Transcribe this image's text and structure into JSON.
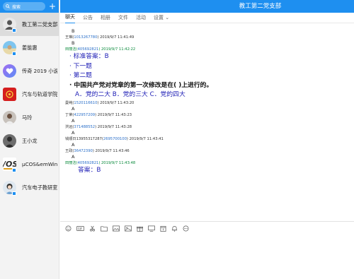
{
  "app": {
    "title": "教工第二党支部"
  },
  "sidebar": {
    "search_label": "搜索",
    "add_label": "+",
    "conversations": [
      {
        "name": "教工第二党支部"
      },
      {
        "name": "姜能惠"
      },
      {
        "name": "传奇 2019 小说"
      },
      {
        "name": "汽车与轨道学院"
      },
      {
        "name": "马玲"
      },
      {
        "name": "王小龙"
      },
      {
        "name": "μCOS&emWin"
      },
      {
        "name": "汽车电子教研室"
      }
    ]
  },
  "tabs": [
    {
      "label": "聊天"
    },
    {
      "label": "公告"
    },
    {
      "label": "相册"
    },
    {
      "label": "文件"
    },
    {
      "label": "活动"
    },
    {
      "label": "设置 ⌄"
    }
  ],
  "messages": {
    "m0": {
      "body": "B"
    },
    "m1": {
      "name": "王琳(",
      "id": "1013267780",
      "time": ") 2019/9/7 11:41:49",
      "body": "B"
    },
    "m2": {
      "name": "田丽洁(",
      "id": "405692821",
      "time": ") 2019/9/7 11:42:22"
    },
    "q1": "· 标准答案：B",
    "q2": "· 下一题",
    "q3": "· 第二题",
    "q4": "· 中国共产党对党章的第一次修改是在( )上进行的。",
    "q5": "A．党的二大 B．党的三大 C．党的四大",
    "m3": {
      "name": "曼纯(",
      "id": "1520116610",
      "time": ") 2019/9/7 11:43:20",
      "body": "A"
    },
    "m4": {
      "name": "丁荣(",
      "id": "422957209",
      "time": ") 2019/9/7 11:43:23",
      "body": "A"
    },
    "m5": {
      "name": "洪远(",
      "id": "371488552",
      "time": ") 2019/9/7 11:43:28",
      "body": "A"
    },
    "m6": {
      "name": "钱顺日13955317287(",
      "id": "2695700100",
      "time": ") 2019/9/7 11:43:41",
      "body": "A"
    },
    "m7": {
      "name": "王政(",
      "id": "36472390",
      "time": ") 2019/9/7 11:43:46",
      "body": "A"
    },
    "m8": {
      "name": "田丽洁(",
      "id": "405692821",
      "time": ") 2019/9/7 11:43:48"
    },
    "answer": "答案：B"
  },
  "toolbar_icons": [
    "emoji-icon",
    "gif-icon",
    "scissors-icon",
    "folder-icon",
    "image-icon",
    "picture-icon",
    "gift-icon",
    "screen-icon",
    "calendar-icon",
    "bell-icon",
    "more-icon"
  ],
  "colors": {
    "brand_blue": "#1e8ff0",
    "question_blue": "#1c1cb5",
    "sender_green": "#0a8a3c",
    "link_blue": "#2a6fc9"
  }
}
